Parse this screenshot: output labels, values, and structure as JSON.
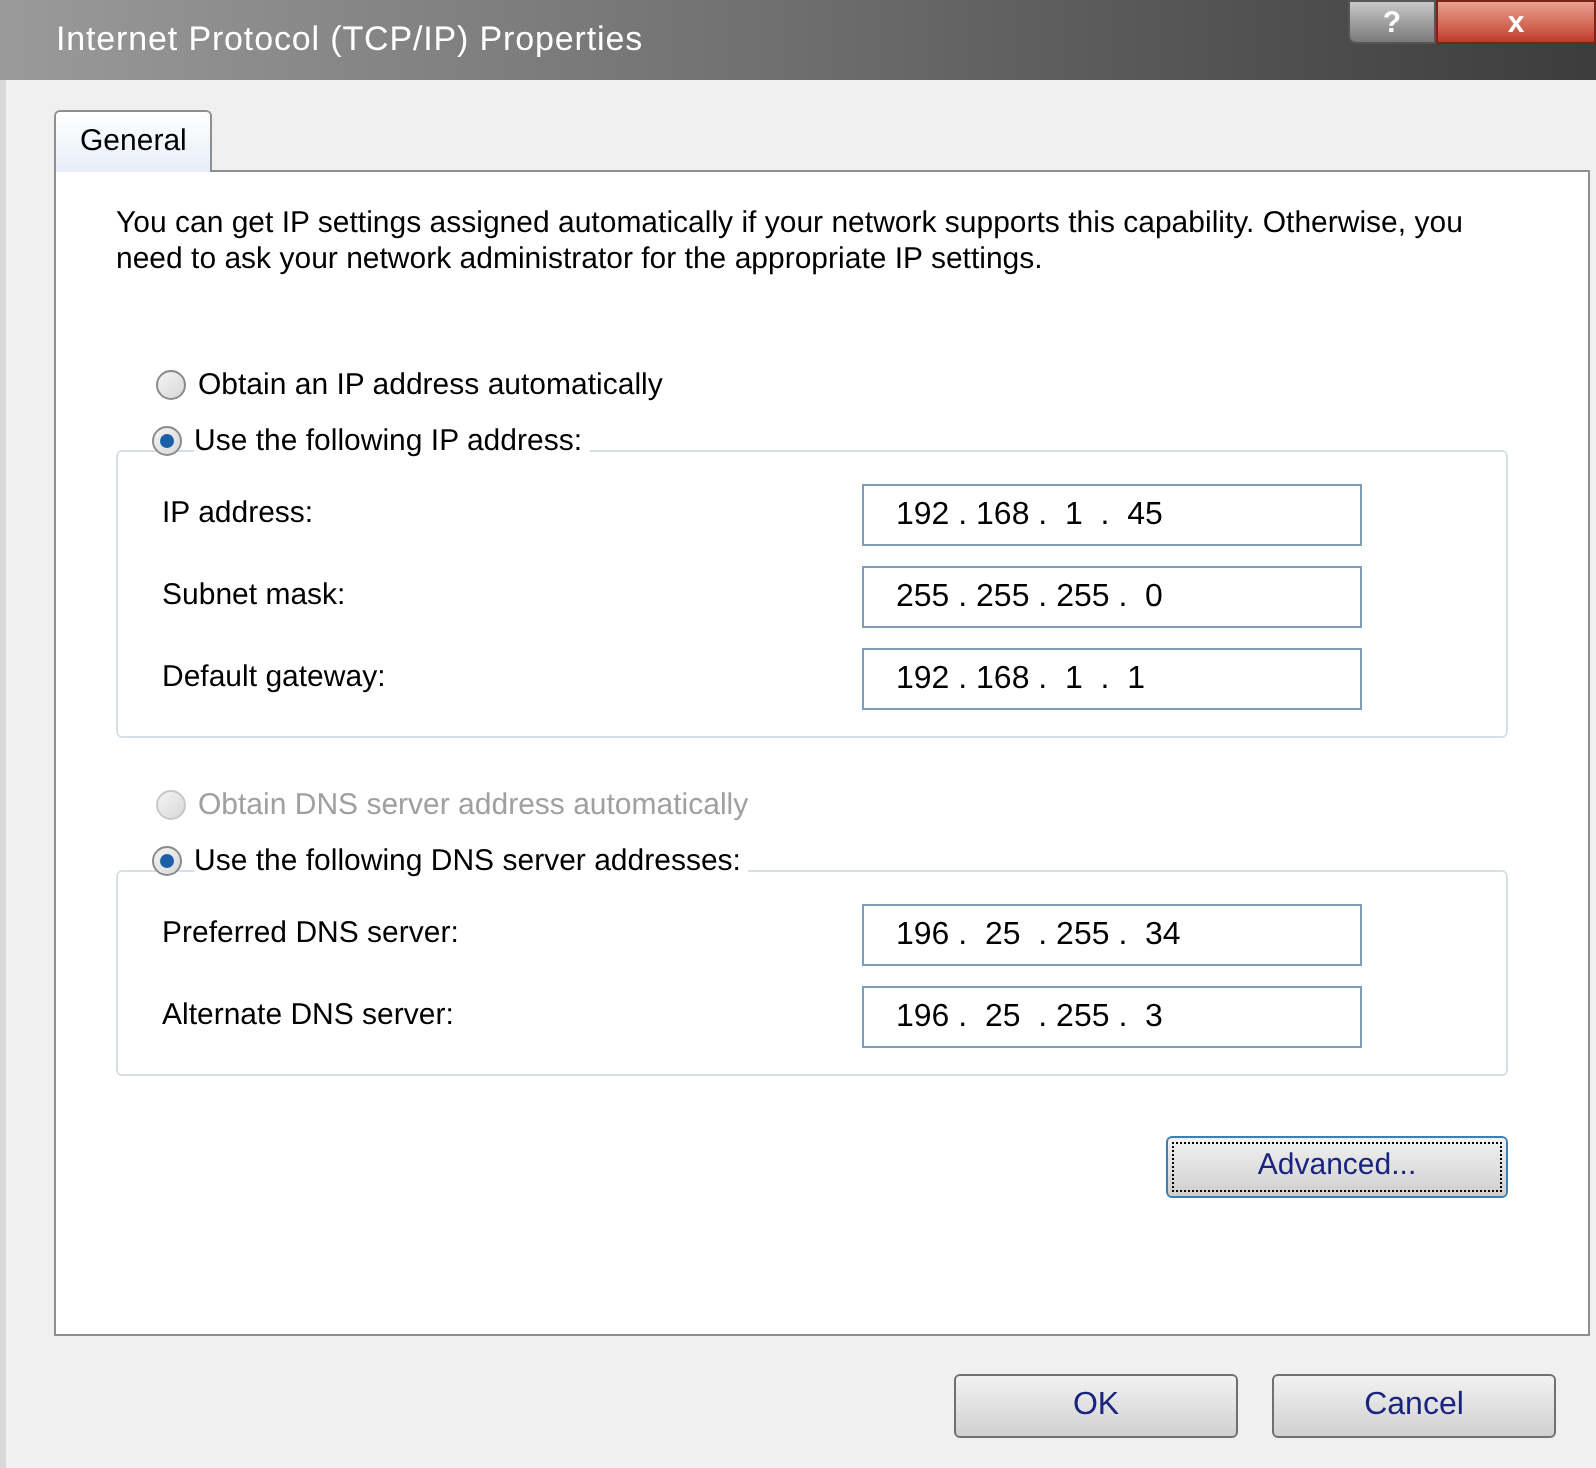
{
  "window": {
    "title": "Internet Protocol (TCP/IP) Properties",
    "help_button": "?",
    "close_button": "x"
  },
  "tabs": [
    {
      "label": "General",
      "selected": true
    }
  ],
  "description": "You can get IP settings assigned automatically if your network supports this capability. Otherwise, you need to ask your network administrator for the appropriate IP settings.",
  "sections": [
    {
      "auto_option": {
        "label": "Obtain an IP address automatically",
        "selected": false,
        "disabled": false
      },
      "manual_option": {
        "label": "Use the following IP address:",
        "selected": true,
        "disabled": false
      },
      "fields": [
        {
          "label": "IP address:",
          "value": "192 . 168 .  1  .  45"
        },
        {
          "label": "Subnet mask:",
          "value": "255 . 255 . 255 .  0"
        },
        {
          "label": "Default gateway:",
          "value": "192 . 168 .  1  .  1"
        }
      ]
    },
    {
      "auto_option": {
        "label": "Obtain DNS server address automatically",
        "selected": false,
        "disabled": true
      },
      "manual_option": {
        "label": "Use the following DNS server addresses:",
        "selected": true,
        "disabled": false
      },
      "fields": [
        {
          "label": "Preferred DNS server:",
          "value": "196 .  25  . 255 .  34"
        },
        {
          "label": "Alternate DNS server:",
          "value": "196 .  25  . 255 .  3"
        }
      ]
    }
  ],
  "advanced_button": "Advanced...",
  "buttons": [
    "OK",
    "Cancel"
  ]
}
